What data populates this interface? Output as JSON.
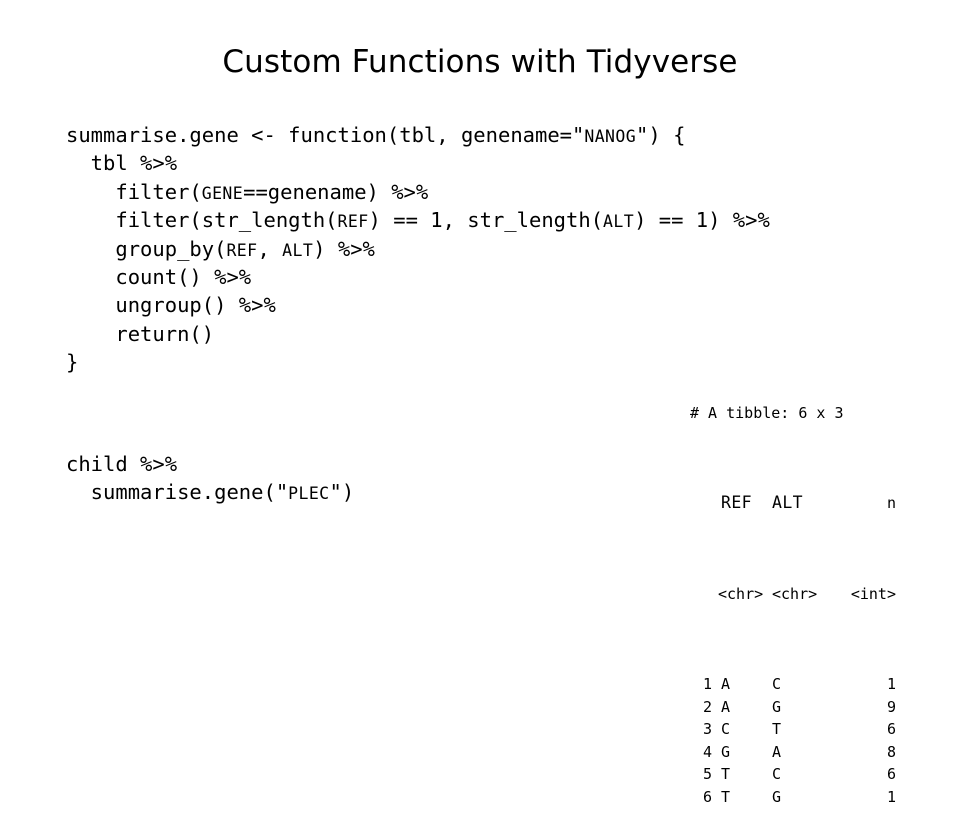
{
  "slide": {
    "title": "Custom Functions with Tidyverse"
  },
  "code_main": {
    "lines": [
      [
        {
          "t": "summarise.gene <- function(tbl, genename=\"",
          "sc": false
        },
        {
          "t": "NANOG",
          "sc": true
        },
        {
          "t": "\") {",
          "sc": false
        }
      ],
      [
        {
          "t": "  tbl %>%",
          "sc": false
        }
      ],
      [
        {
          "t": "    filter(",
          "sc": false
        },
        {
          "t": "GENE",
          "sc": true
        },
        {
          "t": "==genename) %>%",
          "sc": false
        }
      ],
      [
        {
          "t": "    filter(str_length(",
          "sc": false
        },
        {
          "t": "REF",
          "sc": true
        },
        {
          "t": ") == 1, str_length(",
          "sc": false
        },
        {
          "t": "ALT",
          "sc": true
        },
        {
          "t": ") == 1) %>%",
          "sc": false
        }
      ],
      [
        {
          "t": "    group_by(",
          "sc": false
        },
        {
          "t": "REF",
          "sc": true
        },
        {
          "t": ", ",
          "sc": false
        },
        {
          "t": "ALT",
          "sc": true
        },
        {
          "t": ") %>%",
          "sc": false
        }
      ],
      [
        {
          "t": "    count() %>%",
          "sc": false
        }
      ],
      [
        {
          "t": "    ungroup() %>%",
          "sc": false
        }
      ],
      [
        {
          "t": "    return()",
          "sc": false
        }
      ],
      [
        {
          "t": "}",
          "sc": false
        }
      ]
    ]
  },
  "code_call": {
    "lines": [
      [
        {
          "t": "child %>%",
          "sc": false
        }
      ],
      [
        {
          "t": "  summarise.gene(\"",
          "sc": false
        },
        {
          "t": "PLEC",
          "sc": true
        },
        {
          "t": "\")",
          "sc": false
        }
      ]
    ]
  },
  "tibble": {
    "caption": "# A tibble: 6 x 3",
    "headers": {
      "index": "",
      "ref": "REF",
      "alt": "ALT",
      "n": "n"
    },
    "types": {
      "index": "",
      "ref": "<chr>",
      "alt": "<chr>",
      "n": "<int>"
    },
    "rows": [
      {
        "index": "1",
        "ref": "A",
        "alt": "C",
        "n": "1"
      },
      {
        "index": "2",
        "ref": "A",
        "alt": "G",
        "n": "9"
      },
      {
        "index": "3",
        "ref": "C",
        "alt": "T",
        "n": "6"
      },
      {
        "index": "4",
        "ref": "G",
        "alt": "A",
        "n": "8"
      },
      {
        "index": "5",
        "ref": "T",
        "alt": "C",
        "n": "6"
      },
      {
        "index": "6",
        "ref": "T",
        "alt": "G",
        "n": "1"
      }
    ]
  },
  "colors": {
    "background": "#ffffff",
    "text": "#000000"
  }
}
